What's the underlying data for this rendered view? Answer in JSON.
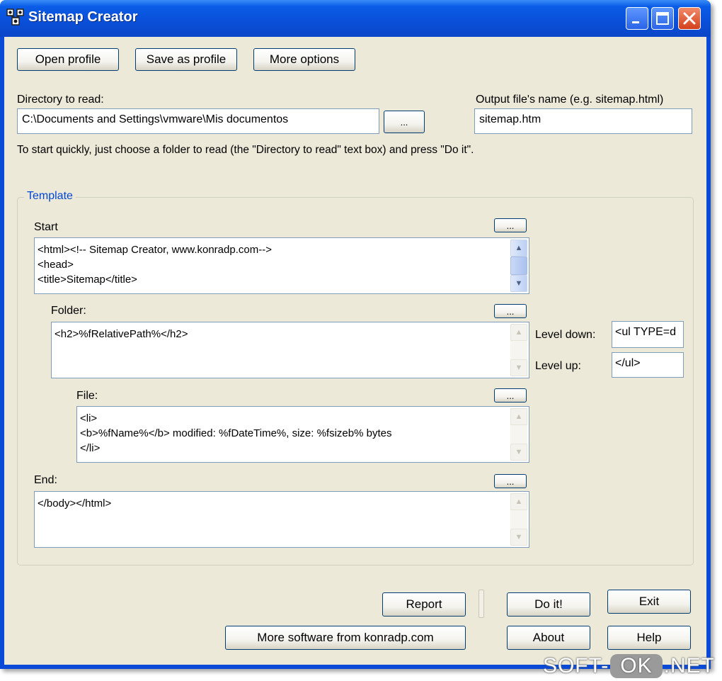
{
  "window": {
    "title": "Sitemap Creator",
    "accent": "#0a4ad6",
    "client_bg": "#ece9d8",
    "close_color": "#d4401c"
  },
  "toolbar": {
    "open_profile": "Open profile",
    "save_as_profile": "Save as profile",
    "more_options": "More options"
  },
  "directory": {
    "label": "Directory to read:",
    "value": "C:\\Documents and Settings\\vmware\\Mis documentos",
    "browse_label": "...",
    "hint": "To start quickly, just choose a folder to read (the \"Directory to read\" text box) and press \"Do it\"."
  },
  "output": {
    "label": "Output file's name (e.g. sitemap.html)",
    "value": "sitemap.htm"
  },
  "template": {
    "legend": "Template",
    "start": {
      "label": "Start",
      "browse_label": "...",
      "content": "<html><!-- Sitemap Creator, www.konradp.com-->\n<head>\n<title>Sitemap</title>"
    },
    "folder": {
      "label": "Folder:",
      "browse_label": "...",
      "content": "<h2>%fRelativePath%</h2>"
    },
    "file": {
      "label": "File:",
      "browse_label": "...",
      "content": "<li>\n<b>%fName%</b> modified: %fDateTime%, size: %fsizeb% bytes\n</li>"
    },
    "end": {
      "label": "End:",
      "browse_label": "...",
      "content": "</body></html>"
    },
    "level_down": {
      "label": "Level down:",
      "value": "<ul TYPE=d"
    },
    "level_up": {
      "label": "Level up:",
      "value": "</ul>"
    }
  },
  "actions": {
    "report": "Report",
    "do_it": "Do it!",
    "exit": "Exit",
    "more_software": "More software from konradp.com",
    "about": "About",
    "help": "Help"
  },
  "watermark": {
    "left": "SOFT-",
    "mid": "OK",
    "right": ".NET"
  }
}
